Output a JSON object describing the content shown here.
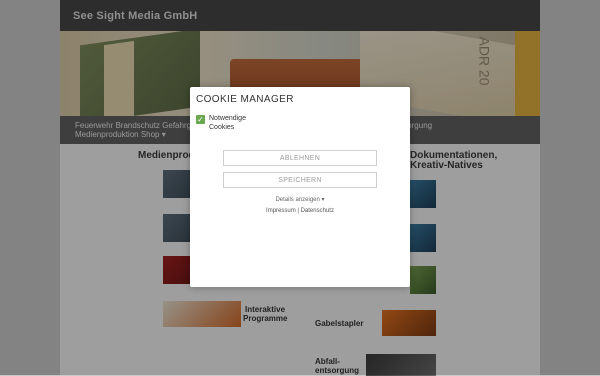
{
  "site": {
    "title": "See Sight Media GmbH"
  },
  "banner": {
    "text": "ADR 20"
  },
  "nav": {
    "line1": "Feuerwehr  Brandschutz  Gefahrgut  Ladungssicherung  Gabelstapler  Arbeitsschutz  Traumaversorgung",
    "line2": "Medienproduktion  Shop ▾"
  },
  "main": {
    "left_heading": "Medienproduktion",
    "right_heading_1": "Dokumentationen,",
    "right_heading_2": "Kreativ-Natives",
    "items": {
      "interaktive_1": "Interaktive",
      "interaktive_2": "Programme",
      "gabelstapler": "Gabelstapler",
      "abfall_1": "Abfall-",
      "abfall_2": "entsorgung"
    }
  },
  "cookie": {
    "title": "COOKIE MANAGER",
    "checkbox_label": "Notwendige Cookies",
    "checkbox_checked": true,
    "reject_label": "ABLEHNEN",
    "save_label": "SPEICHERN",
    "details_label": "Details anzeigen ▾",
    "links": "Impressum | Datenschutz",
    "accent_color": "#6aa84f"
  }
}
